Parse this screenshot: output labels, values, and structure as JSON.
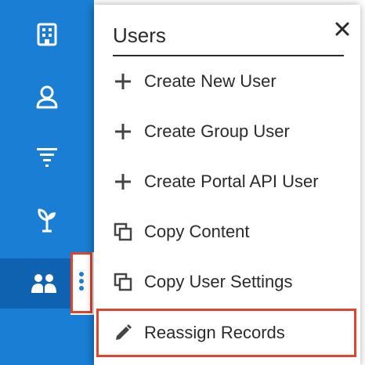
{
  "colors": {
    "sidebar": "#1a7fd4",
    "sidebar_active": "#0f62b0",
    "highlight_outline": "#e0452f",
    "text": "#2b2b2b"
  },
  "sidebar": {
    "items": [
      {
        "icon": "building-icon"
      },
      {
        "icon": "contact-icon"
      },
      {
        "icon": "filter-icon"
      },
      {
        "icon": "sprout-icon"
      },
      {
        "icon": "users-icon",
        "active": true
      }
    ],
    "more_icon": "vertical-ellipsis-icon"
  },
  "panel": {
    "title": "Users",
    "close_icon": "close-icon",
    "items": [
      {
        "label": "Create New User",
        "icon": "plus-icon"
      },
      {
        "label": "Create Group User",
        "icon": "plus-icon"
      },
      {
        "label": "Create Portal API User",
        "icon": "plus-icon"
      },
      {
        "label": "Copy Content",
        "icon": "copy-icon"
      },
      {
        "label": "Copy User Settings",
        "icon": "copy-icon"
      },
      {
        "label": "Reassign Records",
        "icon": "pencil-icon",
        "highlighted": true
      }
    ]
  }
}
